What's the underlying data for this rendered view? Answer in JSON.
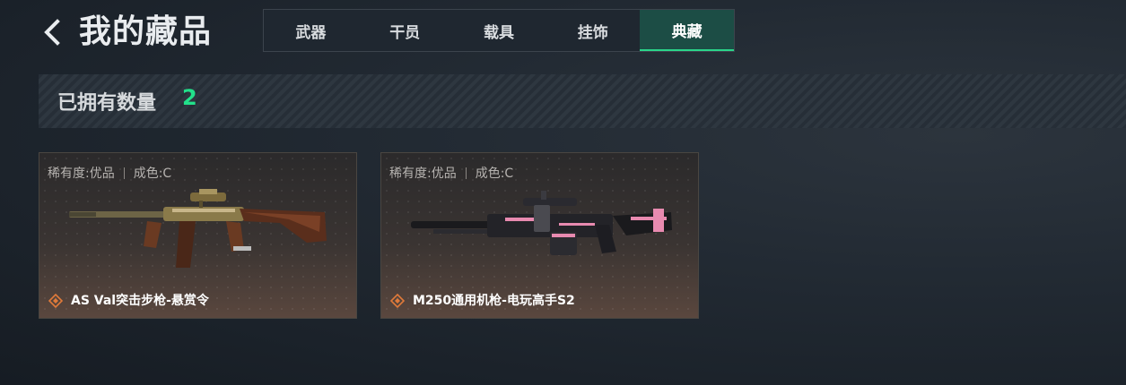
{
  "header": {
    "title": "我的藏品",
    "tabs": [
      {
        "label": "武器"
      },
      {
        "label": "干员"
      },
      {
        "label": "载具"
      },
      {
        "label": "挂饰"
      },
      {
        "label": "典藏"
      }
    ],
    "active_tab": "典藏"
  },
  "owned": {
    "label": "已拥有数量",
    "count": "2"
  },
  "colors": {
    "accent": "#22e08a",
    "active_tab_bg": "#1c4d45",
    "rarity_icon": "#e07a3a",
    "weapon2_accent": "#e88ab0"
  },
  "cards": [
    {
      "rarity": "稀有度:优品",
      "condition": "成色:C",
      "name": "AS Val突击步枪-悬赏令",
      "icon": "rarity-diamond-icon"
    },
    {
      "rarity": "稀有度:优品",
      "condition": "成色:C",
      "name": "M250通用机枪-电玩高手S2",
      "icon": "rarity-diamond-icon"
    }
  ]
}
